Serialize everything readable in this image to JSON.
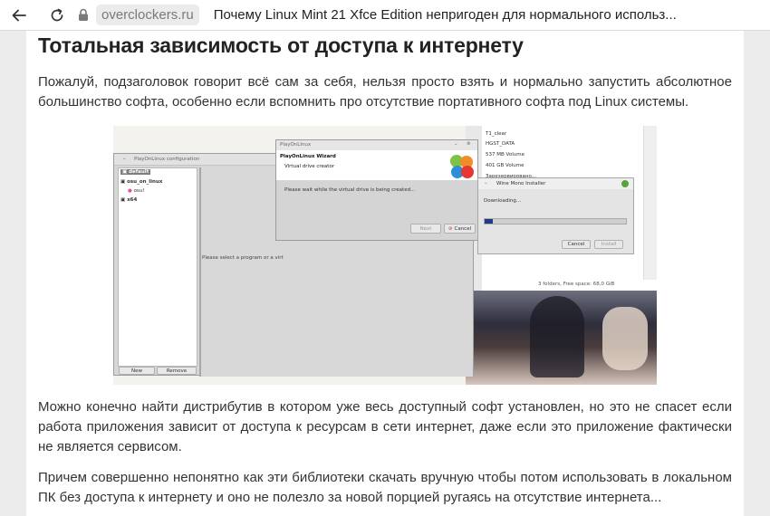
{
  "browser": {
    "domain": "overclockers.ru",
    "page_title": "Почему Linux Mint 21 Xfce Edition непригоден для нормального использ..."
  },
  "article": {
    "heading": "Тотальная зависимость от доступа к интернету",
    "p1": "Пожалуй, подзаголовок говорит всё сам за себя, нельзя просто взять и нормально запустить абсолютное большинство софта, особенно если вспомнить про отсутствие портативного софта под Linux системы.",
    "p2": "Можно конечно найти дистрибутив в котором уже весь доступный софт установлен, но это не спасет если работа приложения зависит от доступа к ресурсам в сети интернет, даже если это приложение фактически не является сервисом.",
    "p3": "Причем совершенно непонятно как эти библиотеки скачать вручную чтобы потом использовать в локальном ПК без доступа к интернету и оно не полезло за новой порцией ругаясь на отсутствие интернета..."
  },
  "screenshot": {
    "pol_config_title": "PlayOnLinux configuration",
    "prefixes": [
      "default",
      "osu_on_linux",
      "osu!",
      "x64"
    ],
    "select_text": "Please select a program or a virt",
    "new_label": "New",
    "remove_label": "Remove",
    "wizard_title": "PlayOnLinux",
    "wizard_heading": "PlayOnLinux Wizard",
    "wizard_sub": "Virtual drive creator",
    "wizard_wait": "Please wait while the virtual drive is being created...",
    "next_label": "Next",
    "cancel_label": "Cancel",
    "files": [
      "T1_clear",
      "HGST_DATA",
      "537 MB Volume",
      "401 GB Volume",
      "Зарезервировано..."
    ],
    "files_status": "3 folders, Free space: 68,0 GiB",
    "mono_title": "Wine Mono Installer",
    "mono_downloading": "Downloading...",
    "mono_cancel": "Cancel",
    "mono_install": "Install"
  }
}
